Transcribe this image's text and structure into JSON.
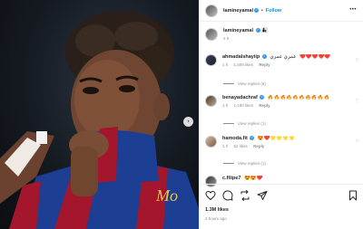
{
  "post": {
    "username": "lamineyamal",
    "follow_label": "Follow",
    "separator": "•",
    "more_icon": "•••",
    "next_icon": "›"
  },
  "caption": {
    "username": "lamineyamal",
    "emoji": "👩‍👦",
    "time": "2 h"
  },
  "comments": [
    {
      "username": "ahmadalshayiip",
      "text_rtl": "عمري عمري",
      "text": "❤️❤️❤️❤️❤️",
      "time": "1 h",
      "likes": "1,509 likes",
      "reply": "Reply",
      "view_replies": "View replies (6)"
    },
    {
      "username": "benayadachraf",
      "text": "🔥🔥🔥🔥🔥🔥🔥🔥🔥🔥",
      "time": "1 h",
      "likes": "1,190 likes",
      "reply": "Reply",
      "view_replies": "View replies (1)"
    },
    {
      "username": "hamoda.fit",
      "text": "😍❤️🌟🌟🌟🌟",
      "time": "1 h",
      "likes": "52 likes",
      "reply": "Reply",
      "view_replies": "View replies (1)"
    },
    {
      "username": "c.filipe7",
      "text": "😍😍❤️",
      "time": "",
      "likes": "",
      "reply": "",
      "view_replies": ""
    }
  ],
  "actions": {
    "likes": "1.3M likes",
    "posted": "2 hours ago",
    "icons": [
      "heart-icon",
      "comment-icon",
      "share-icon",
      "send-icon",
      "bookmark-icon"
    ]
  },
  "colors": {
    "verified": "#3897f0",
    "follow": "#0095f6",
    "muted": "#8e8e8e",
    "jersey_blue": "#1c3f94",
    "jersey_red": "#a3162b"
  }
}
